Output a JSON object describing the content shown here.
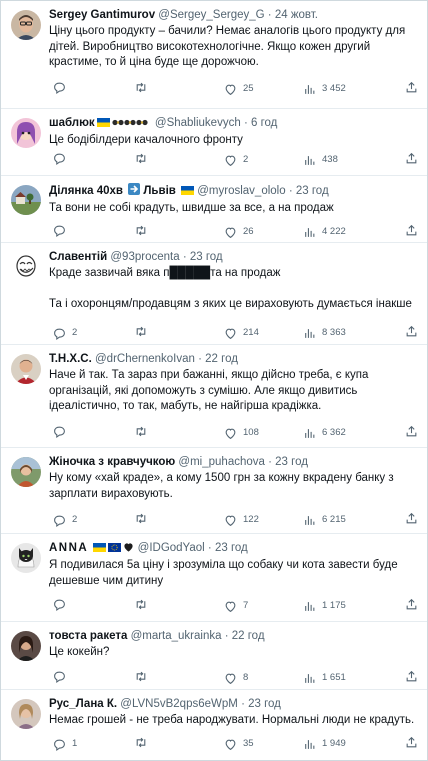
{
  "tweets": [
    {
      "name": "Sergey Gantimurov",
      "badges": [],
      "handle": "@Sergey_Sergey_G",
      "time": "24 жовт.",
      "paragraphs": [
        "Ціну цього продукту – бачили?  Немає аналогів цього продукту для дітей. Виробництво високотехнологічне. Якщо кожен другий крастиме, то й ціна буде ще дорожчою."
      ],
      "replies": "",
      "retweets": "",
      "likes": "25",
      "views": "3 452",
      "avatar": {
        "type": "man-glasses",
        "bg": "#c9b7a3"
      }
    },
    {
      "name": "шаблюк",
      "badges": [
        "ua-flag",
        "beads"
      ],
      "handle": "@Shabliukevych",
      "time": "6 год",
      "paragraphs": [
        "Це бодібілдери качалочного фронту"
      ],
      "replies": "",
      "retweets": "",
      "likes": "2",
      "views": "438",
      "avatar": {
        "type": "cartoon-girl",
        "bg": "#f2c4d8"
      }
    },
    {
      "name": "Ділянка 40хв",
      "badges": [
        "arrow-right"
      ],
      "name_suffix": "Львів",
      "badges2": [
        "ua-flag"
      ],
      "handle": "@myroslav_ololo",
      "time": "23 год",
      "paragraphs": [
        "Та вони не собі крадуть, швидше за все, а на продаж"
      ],
      "replies": "",
      "retweets": "",
      "likes": "26",
      "views": "4 222",
      "avatar": {
        "type": "landscape",
        "bg": "#8aa6c1"
      }
    },
    {
      "name": "Славентій",
      "badges": [],
      "handle": "@93procenta",
      "time": "23 год",
      "paragraphs": [
        "Краде зазвичай вяка п█████та на продаж",
        "Та і охоронцям/продавцям з яких це вираховують думається інакше"
      ],
      "replies": "2",
      "retweets": "",
      "likes": "214",
      "views": "8 363",
      "avatar": {
        "type": "troll",
        "bg": "#ffffff"
      }
    },
    {
      "name": "Т.Н.Х.С.",
      "badges": [],
      "handle": "@drChernenkoIvan",
      "time": "22 год",
      "paragraphs": [
        "Наче й так. Та зараз при бажанні, якщо дійсно треба, є купа організацій, які допоможуть з сумішю. Але якщо дивитись ідеалістично, то так, мабуть, не найгірша крадіжка."
      ],
      "replies": "",
      "retweets": "",
      "likes": "108",
      "views": "6 362",
      "avatar": {
        "type": "doctor",
        "bg": "#d9d0c3"
      }
    },
    {
      "name": "Жіночка з кравчучкою",
      "badges": [],
      "handle": "@mi_puhachova",
      "time": "23 год",
      "paragraphs": [
        "Ну кому «хай краде», а кому 1500 грн за кожну вкрадену банку з зарплати вираховують."
      ],
      "replies": "2",
      "retweets": "",
      "likes": "122",
      "views": "6 215",
      "avatar": {
        "type": "woman-outdoor",
        "bg": "#7f9a6b"
      }
    },
    {
      "name": "ANNA",
      "badges": [
        "ua-flag",
        "eu-flag",
        "heart"
      ],
      "handle": "@IDGodYaol",
      "time": "23 год",
      "paragraphs": [
        "Я подивилася 5а ціну і зрозуміла що собаку чи кота завести буде дешевше чим дитину"
      ],
      "replies": "",
      "retweets": "",
      "likes": "7",
      "views": "1 175",
      "avatar": {
        "type": "cat",
        "bg": "#e7e7e7"
      }
    },
    {
      "name": "товста ракета",
      "badges": [],
      "handle": "@marta_ukrainka",
      "time": "22 год",
      "paragraphs": [
        "Це кокейн?"
      ],
      "replies": "",
      "retweets": "",
      "likes": "8",
      "views": "1 651",
      "avatar": {
        "type": "woman-dark",
        "bg": "#5a4a45"
      }
    },
    {
      "name": "Рус_Лана К.",
      "badges": [],
      "handle": "@LVN5vB2qps6eWpM",
      "time": "23 год",
      "paragraphs": [
        "Немає грошей - не треба народжувати. Нормальні люди не крадуть."
      ],
      "replies": "1",
      "retweets": "",
      "likes": "35",
      "views": "1 949",
      "avatar": {
        "type": "woman-light",
        "bg": "#d4c7bd"
      }
    }
  ]
}
